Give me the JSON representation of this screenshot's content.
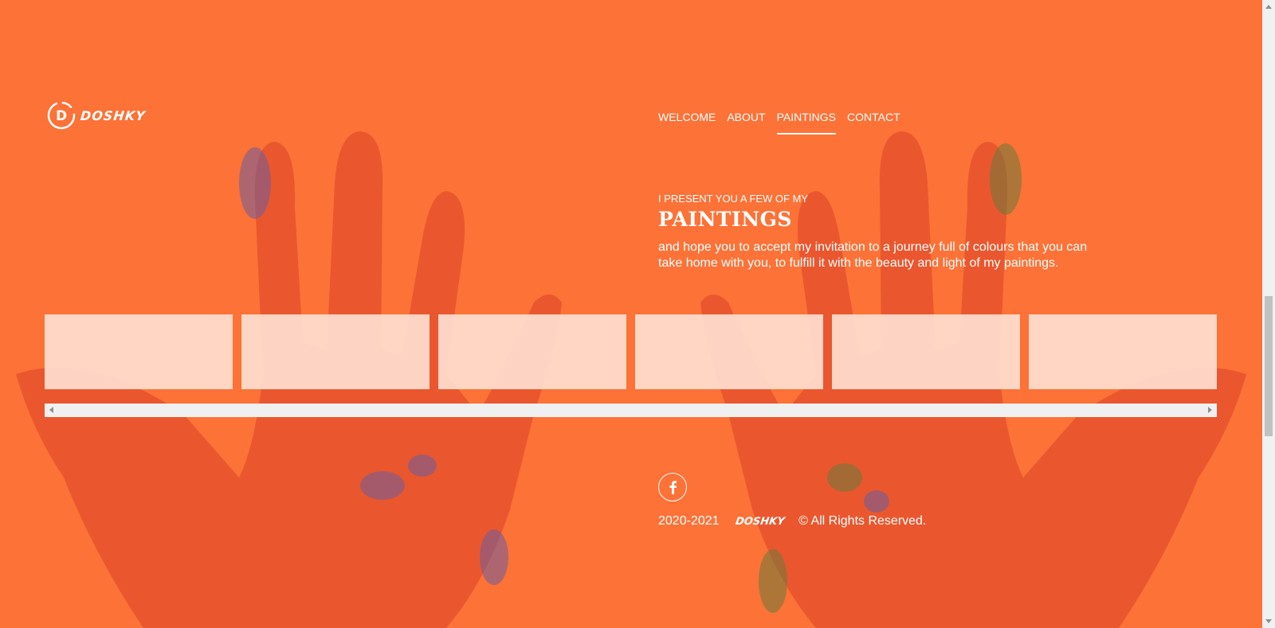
{
  "colors": {
    "background": "#fc7237",
    "hand": "#e8542e",
    "paint_blue": "#6b5d9e",
    "paint_green": "#6a7a3c",
    "tile": "#ffe1d4"
  },
  "brand": {
    "logo_letter": "D",
    "name": "DOSHKY"
  },
  "nav": {
    "items": [
      {
        "label": "WELCOME",
        "active": false
      },
      {
        "label": "ABOUT",
        "active": false
      },
      {
        "label": "PAINTINGS",
        "active": true
      },
      {
        "label": "CONTACT",
        "active": false
      }
    ]
  },
  "intro": {
    "kicker": "I PRESENT YOU A FEW OF MY",
    "heading": "PAINTINGS",
    "description": "and hope you to accept my invitation to a journey full of colours that you can take home with you, to fulfill it with the beauty and light of my paintings."
  },
  "gallery": {
    "tile_count": 6
  },
  "social": {
    "icon": "facebook-icon",
    "letter": "f"
  },
  "footer": {
    "years": "2020-2021",
    "brand": "DOSHKY",
    "rights": "© All Rights Reserved."
  }
}
